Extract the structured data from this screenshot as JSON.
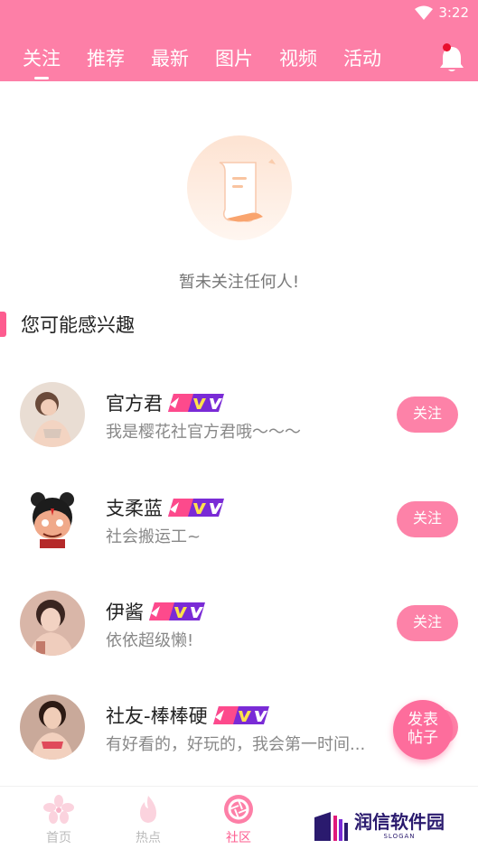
{
  "status_bar": {
    "time": "3:22"
  },
  "tabs": [
    {
      "label": "关注",
      "active": true
    },
    {
      "label": "推荐",
      "active": false
    },
    {
      "label": "最新",
      "active": false
    },
    {
      "label": "图片",
      "active": false
    },
    {
      "label": "视频",
      "active": false
    },
    {
      "label": "活动",
      "active": false
    }
  ],
  "empty_state": {
    "message": "暂未关注任何人!"
  },
  "section": {
    "title": "您可能感兴趣"
  },
  "users": [
    {
      "name": "官方君",
      "desc": "我是樱花社官方君哦～～～",
      "follow_label": "关注"
    },
    {
      "name": "支柔蓝",
      "desc": "社会搬运工~",
      "follow_label": "关注"
    },
    {
      "name": "伊酱",
      "desc": "依依超级懒!",
      "follow_label": "关注"
    },
    {
      "name": "社友-棒棒硬",
      "desc": "有好看的，好玩的，我会第一时间...",
      "follow_label": "关注"
    }
  ],
  "fab": {
    "line1": "发表",
    "line2": "帖子"
  },
  "bottom_nav": [
    {
      "label": "首页",
      "icon": "sakura-icon",
      "active": false
    },
    {
      "label": "热点",
      "icon": "flame-icon",
      "active": false
    },
    {
      "label": "社区",
      "icon": "aperture-icon",
      "active": true
    }
  ],
  "watermark": {
    "title": "润信软件园",
    "slogan": "SLOGAN"
  },
  "colors": {
    "primary": "#fd7fa7",
    "accent": "#fd5c8f",
    "button": "#fd82a8"
  }
}
